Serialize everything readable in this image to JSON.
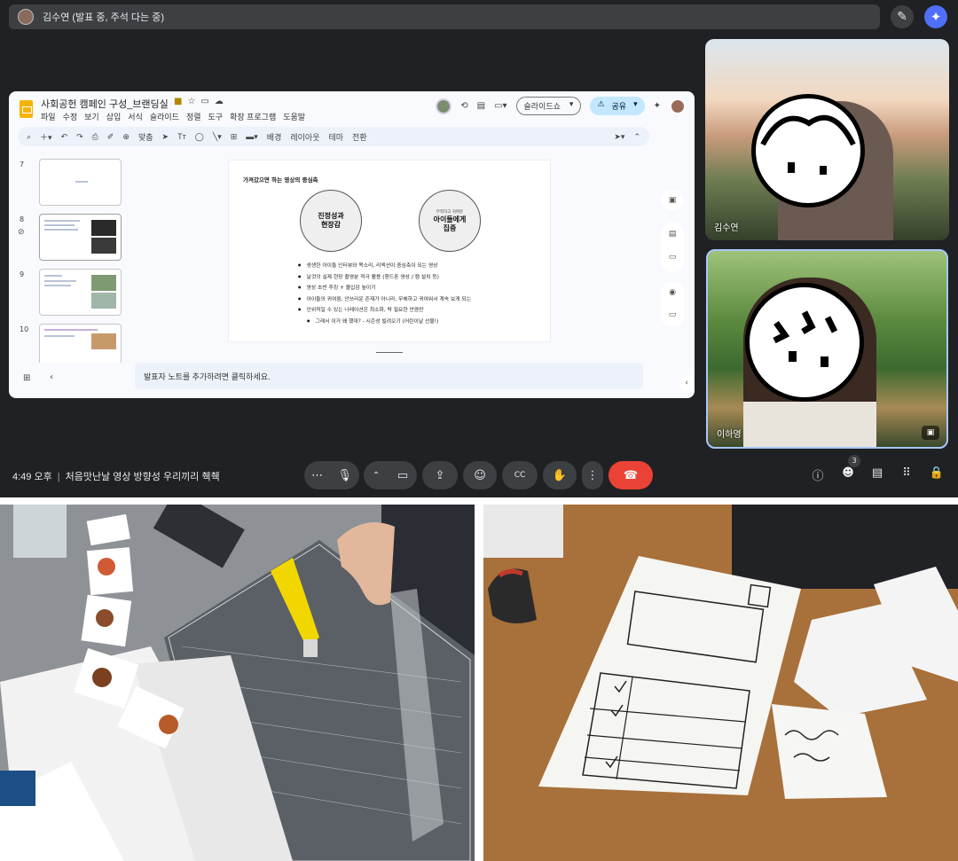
{
  "meet": {
    "presenter_title": "김수연 (발표 중, 주석 다는 중)",
    "clock": "4:49 오후",
    "meeting_name": "처음맛난날 영상 방향성 우리끼리 췍췍",
    "participants_count": "3",
    "participants": [
      {
        "name": "김수연"
      },
      {
        "name": "이하영"
      }
    ]
  },
  "slides": {
    "doc_title": "사회공헌 캠페인 구성_브랜딩실",
    "menu": [
      "파일",
      "수정",
      "보기",
      "삽입",
      "서식",
      "슬라이드",
      "정렬",
      "도구",
      "확장 프로그램",
      "도움말"
    ],
    "slideshow_label": "슬라이드쇼",
    "share_label": "공유",
    "toolbar": {
      "zoom": "맞춤",
      "background": "배경",
      "layout": "레이아웃",
      "theme": "테마",
      "transition": "전환"
    },
    "thumbnails": [
      {
        "num": "7"
      },
      {
        "num": "8"
      },
      {
        "num": "9"
      },
      {
        "num": "10"
      }
    ],
    "current_slide": {
      "heading": "가져갔으면 하는 영상의 중심축",
      "circle_left": "진정성과\n현장감",
      "circle_right_sub": "무력하고 귀여운",
      "circle_right": "아이들에게\n집중",
      "bullets": [
        "생생한 아이들 인터뷰와 목소리, 리액션이 중심축이 되는 영상",
        "날것의 실제 현장 촬영분 적극 활용 (핸드폰 영상 / 캠 설치 등)",
        "영상 초반 후킹 + 몰입감 높이기",
        "아이들의 귀여움, 안쓰러운 존재가 아니라, 무해하고 귀여워서 계속 보게 되는",
        "인위적일 수 있는 나레이션은 최소화, 딱 필요한 만큼만",
        "그래서 이거 왜 했대? - 시즌성 빌려오기 (어린이날 선물!)"
      ]
    },
    "speaker_notes_placeholder": "발표자 노트를 추가하려면 클릭하세요."
  },
  "icons": {
    "pen": "pen-icon",
    "gemini": "gemini-spark-icon",
    "mic": "mic-icon",
    "camera": "camera-icon",
    "present": "present-screen-icon",
    "emoji": "emoji-icon",
    "captions": "captions-icon",
    "raise_hand": "raise-hand-icon",
    "end_call": "end-call-icon"
  },
  "colors": {
    "meet_bg": "#202124",
    "end_call": "#ea4335",
    "share_button": "#c2e7ff",
    "active_tile_border": "#a8c7fa"
  }
}
